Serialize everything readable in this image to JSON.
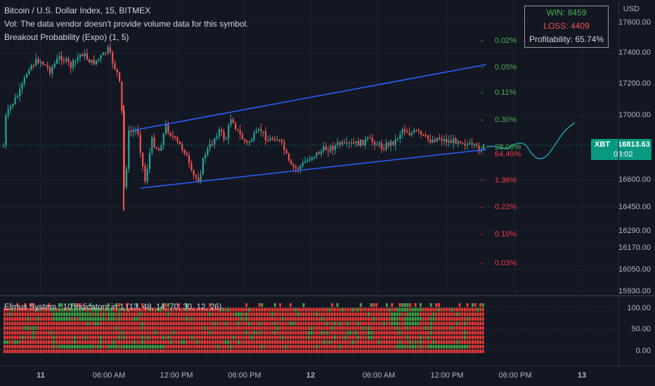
{
  "header": {
    "symbol_line": "Bitcoin / U.S. Dollar Index, 15, BITMEX",
    "vol_line": "Vol: The data vendor doesn't provide volume data for this symbol.",
    "indicator_line": "Breakout Probability (Expo) (1, 5)"
  },
  "stats": {
    "win": "WIN: 8459",
    "loss": "LOSS: 4409",
    "profitability": "Profitability: 65.74%"
  },
  "price_scale": {
    "currency": "USD",
    "ticks": [
      "17600.00",
      "17400.00",
      "17200.00",
      "17000.00",
      "16600.00",
      "16450.00",
      "16290.00",
      "16170.00",
      "16050.00",
      "15930.00"
    ]
  },
  "price_badge": {
    "symbol": "XBT",
    "price": "16813.63",
    "countdown": "03:02"
  },
  "probabilities": {
    "upper": [
      "0.02%",
      "0.05%",
      "0.11%",
      "0.30%",
      "28.06%"
    ],
    "lower": [
      "64.49%",
      "1.36%",
      "0.22%",
      "0.10%",
      "0.03%"
    ]
  },
  "oscillator": {
    "title": "Efmus System : 10 indicators in 1 (13, 48, 14, 70, 30, 12, 26)",
    "ticks": [
      "100.00",
      "50.00",
      "0.00"
    ]
  },
  "time_axis": [
    "11",
    "06:00 AM",
    "12:00 PM",
    "06:00 PM",
    "12",
    "06:00 AM",
    "12:00 PM",
    "06:00 PM",
    "13"
  ],
  "colors": {
    "up": "#26a69a",
    "down": "#ef5350",
    "channel": "#2962ff",
    "green_prob": "#4caf50",
    "red_prob": "#f23645"
  }
}
